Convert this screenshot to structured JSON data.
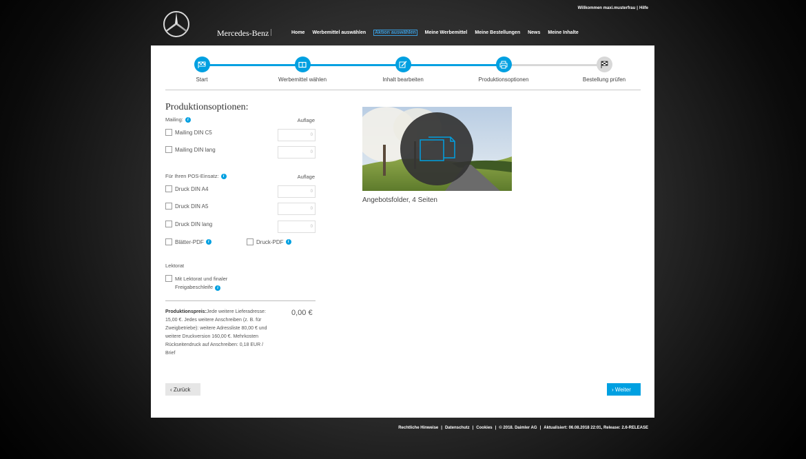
{
  "header": {
    "welcome": "Willkommen maxi.musterfrau",
    "help": "Hilfe",
    "brand": "Mercedes-Benz",
    "nav": [
      {
        "label": "Home",
        "active": false
      },
      {
        "label": "Werbemittel auswählen",
        "active": false
      },
      {
        "label": "Aktion auswählen",
        "active": true
      },
      {
        "label": "Meine Werbemittel",
        "active": false
      },
      {
        "label": "Meine Bestellungen",
        "active": false
      },
      {
        "label": "News",
        "active": false
      },
      {
        "label": "Meine Inhalte",
        "active": false
      }
    ]
  },
  "stepper": {
    "steps": [
      {
        "label": "Start",
        "icon": "flag-icon",
        "done": true
      },
      {
        "label": "Werbemittel wählen",
        "icon": "brochure-icon",
        "done": true
      },
      {
        "label": "Inhalt bearbeiten",
        "icon": "edit-icon",
        "done": true
      },
      {
        "label": "Produktionsoptionen",
        "icon": "printer-icon",
        "done": true
      },
      {
        "label": "Bestellung prüfen",
        "icon": "checkered-flag-icon",
        "done": false
      }
    ]
  },
  "form": {
    "title": "Produktionsoptionen:",
    "mailing": {
      "label": "Mailing:",
      "auflage": "Auflage",
      "options": [
        {
          "label": "Mailing DIN C5",
          "quantity": "0"
        },
        {
          "label": "Mailing DIN lang",
          "quantity": "0"
        }
      ]
    },
    "pos": {
      "label": "Für Ihren POS-Einsatz:",
      "auflage": "Auflage",
      "options": [
        {
          "label": "Druck DIN A4",
          "quantity": "0"
        },
        {
          "label": "Druck DIN A5",
          "quantity": "0"
        },
        {
          "label": "Druck DIN lang",
          "quantity": "0"
        }
      ],
      "pdf_blaetter": "Blätter-PDF",
      "pdf_druck": "Druck-PDF"
    },
    "lektorat": {
      "label": "Lektorat",
      "option_line1": "Mit Lektorat und finaler",
      "option_line2": "Freigabeschleife"
    },
    "price": {
      "label": "Produktionspreis:",
      "text": "Jede weitere Lieferadresse: 15,00 €. Jedes weitere Anschreiben (z. B. für Zweigbetriebe): weitere Adressliste 80,00 € und weitere Druckversion 160,00 €. Mehrkosten Rückseitendruck auf Anschreiben: 0,18 EUR / Brief",
      "value": "0,00 €"
    },
    "back_label": "‹ Zurück",
    "next_label": "› Weiter"
  },
  "preview": {
    "caption": "Angebotsfolder, 4 Seiten"
  },
  "footer": {
    "links": [
      "Rechtliche Hinweise",
      "Datenschutz",
      "Cookies"
    ],
    "copyright": "© 2018. Daimler AG",
    "updated": "Aktualisiert: 06.08.2018 22:01, Release: 2.6-RELEASE"
  },
  "colors": {
    "accent": "#00a0e1",
    "inactive_step": "#d8d8d8"
  }
}
